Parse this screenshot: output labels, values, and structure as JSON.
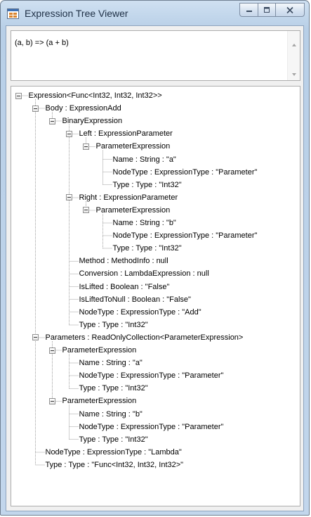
{
  "window": {
    "title": "Expression Tree Viewer",
    "icon": "windows-forms-app-icon"
  },
  "expression_box": {
    "text": "(a, b) => (a + b)"
  },
  "tree": {
    "nodes": [
      {
        "label": "Expression<Func<Int32, Int32, Int32>>",
        "expanded": true
      },
      {
        "label": "Body : ExpressionAdd",
        "expanded": true
      },
      {
        "label": "BinaryExpression",
        "expanded": true
      },
      {
        "label": "Left : ExpressionParameter",
        "expanded": true
      },
      {
        "label": "ParameterExpression",
        "expanded": true
      },
      {
        "label": "Name : String : \"a\""
      },
      {
        "label": "NodeType : ExpressionType : \"Parameter\""
      },
      {
        "label": "Type : Type : \"Int32\""
      },
      {
        "label": "Right : ExpressionParameter",
        "expanded": true
      },
      {
        "label": "ParameterExpression",
        "expanded": true
      },
      {
        "label": "Name : String : \"b\""
      },
      {
        "label": "NodeType : ExpressionType : \"Parameter\""
      },
      {
        "label": "Type : Type : \"Int32\""
      },
      {
        "label": "Method : MethodInfo : null"
      },
      {
        "label": "Conversion : LambdaExpression : null"
      },
      {
        "label": "IsLifted : Boolean : \"False\""
      },
      {
        "label": "IsLiftedToNull : Boolean : \"False\""
      },
      {
        "label": "NodeType : ExpressionType : \"Add\""
      },
      {
        "label": "Type : Type : \"Int32\""
      },
      {
        "label": "Parameters : ReadOnlyCollection<ParameterExpression>",
        "expanded": true
      },
      {
        "label": "ParameterExpression",
        "expanded": true
      },
      {
        "label": "Name : String : \"a\""
      },
      {
        "label": "NodeType : ExpressionType : \"Parameter\""
      },
      {
        "label": "Type : Type : \"Int32\""
      },
      {
        "label": "ParameterExpression",
        "expanded": true
      },
      {
        "label": "Name : String : \"b\""
      },
      {
        "label": "NodeType : ExpressionType : \"Parameter\""
      },
      {
        "label": "Type : Type : \"Int32\""
      },
      {
        "label": "NodeType : ExpressionType : \"Lambda\""
      },
      {
        "label": "Type : Type : \"Func<Int32, Int32, Int32>\""
      }
    ]
  }
}
